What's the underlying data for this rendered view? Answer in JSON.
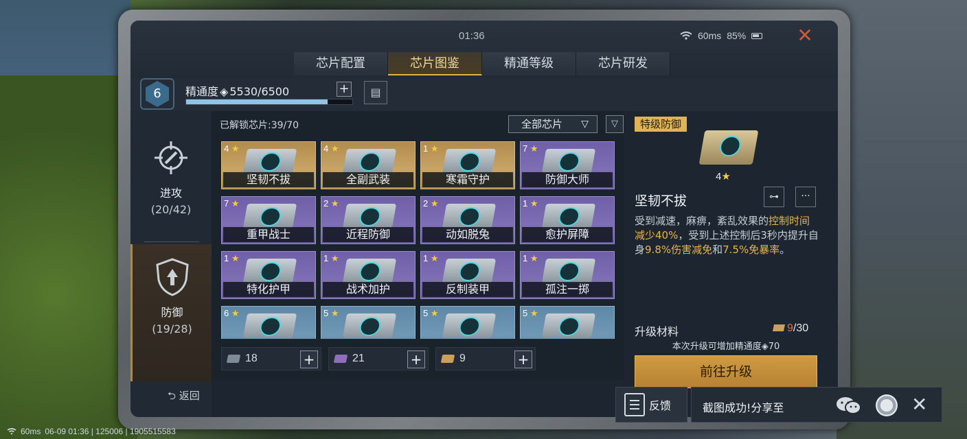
{
  "status": {
    "time": "01:36",
    "ping": "60ms",
    "battery": "85%"
  },
  "tabs": [
    {
      "label": "芯片配置",
      "active": false
    },
    {
      "label": "芯片图鉴",
      "active": true
    },
    {
      "label": "精通等级",
      "active": false
    },
    {
      "label": "芯片研发",
      "active": false
    }
  ],
  "mastery": {
    "level": "6",
    "label": "精通度",
    "current": "5530/6500",
    "progress": 0.85,
    "plus": "+"
  },
  "sidebar": {
    "attack": {
      "label": "进攻",
      "count": "(20/42)"
    },
    "defense": {
      "label": "防御",
      "count": "(19/28)"
    }
  },
  "grid": {
    "unlocked": "已解锁芯片:39/70",
    "filter": "全部芯片",
    "chips": [
      {
        "stars": "4",
        "name": "坚韧不拔",
        "rarity": "gold"
      },
      {
        "stars": "4",
        "name": "全副武装",
        "rarity": "gold"
      },
      {
        "stars": "1",
        "name": "寒霜守护",
        "rarity": "gold"
      },
      {
        "stars": "7",
        "name": "防御大师",
        "rarity": "purple"
      },
      {
        "stars": "7",
        "name": "重甲战士",
        "rarity": "purple"
      },
      {
        "stars": "2",
        "name": "近程防御",
        "rarity": "purple"
      },
      {
        "stars": "2",
        "name": "动如脱兔",
        "rarity": "purple"
      },
      {
        "stars": "1",
        "name": "愈护屏障",
        "rarity": "purple"
      },
      {
        "stars": "1",
        "name": "特化护甲",
        "rarity": "purple"
      },
      {
        "stars": "1",
        "name": "战术加护",
        "rarity": "purple"
      },
      {
        "stars": "1",
        "name": "反制装甲",
        "rarity": "purple"
      },
      {
        "stars": "1",
        "name": "孤注一掷",
        "rarity": "purple"
      },
      {
        "stars": "6",
        "name": "",
        "rarity": "blue"
      },
      {
        "stars": "5",
        "name": "",
        "rarity": "blue"
      },
      {
        "stars": "5",
        "name": "",
        "rarity": "blue"
      },
      {
        "stars": "5",
        "name": "",
        "rarity": "blue"
      }
    ]
  },
  "materials": [
    {
      "value": "18",
      "kind": "gray"
    },
    {
      "value": "21",
      "kind": "purple"
    },
    {
      "value": "9",
      "kind": "gold"
    }
  ],
  "detail": {
    "rarity": "特级防御",
    "stars": "4",
    "name": "坚韧不拔",
    "desc_1": "受到减速，麻痹，紊乱效果的",
    "desc_hl1": "控制时间减少40%",
    "desc_2": "，受到上述控制后3秒内提升自身",
    "desc_hl2": "9.8%伤害减免",
    "desc_3": "和",
    "desc_hl3": "7.5%免暴率",
    "desc_4": "。",
    "upgrade_label": "升级材料",
    "upgrade_current": "9",
    "upgrade_total": "/30",
    "upgrade_note": "本次升级可增加精通度",
    "upgrade_note_value": "70",
    "go_button": "前往升级"
  },
  "back": "返回",
  "feedback": "反馈",
  "share": {
    "text": "截图成功!分享至"
  },
  "netline": {
    "ping": "60ms",
    "info": "06-09 01:36 | 125006 | 1905515583"
  }
}
